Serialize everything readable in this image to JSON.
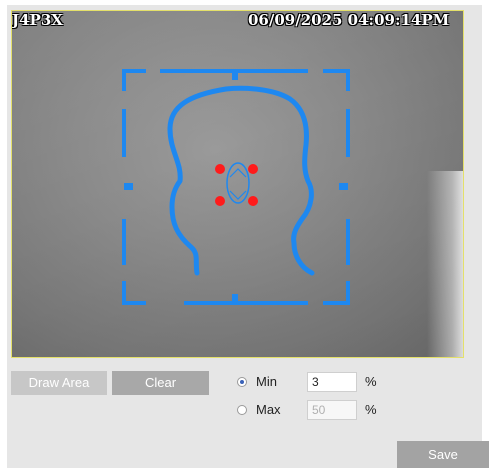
{
  "video": {
    "osd_name": "J4P3X",
    "osd_datetime": "06/09/2025 04:09:14PM"
  },
  "toolbar": {
    "draw_area_label": "Draw Area",
    "clear_label": "Clear"
  },
  "size_filter": {
    "min_label": "Min",
    "min_value": "3",
    "min_unit": "%",
    "max_label": "Max",
    "max_value": "50",
    "max_unit": "%",
    "selected": "min"
  },
  "footer": {
    "save_label": "Save"
  },
  "colors": {
    "overlay_blue": "#1e88f0",
    "marker_red": "#ff1b1b",
    "video_border": "#e4e06a"
  },
  "icons": {
    "face_frame": "face-detection-frame-icon",
    "head_outline": "head-outline-icon",
    "eye_points": "face-landmark-points-icon"
  }
}
